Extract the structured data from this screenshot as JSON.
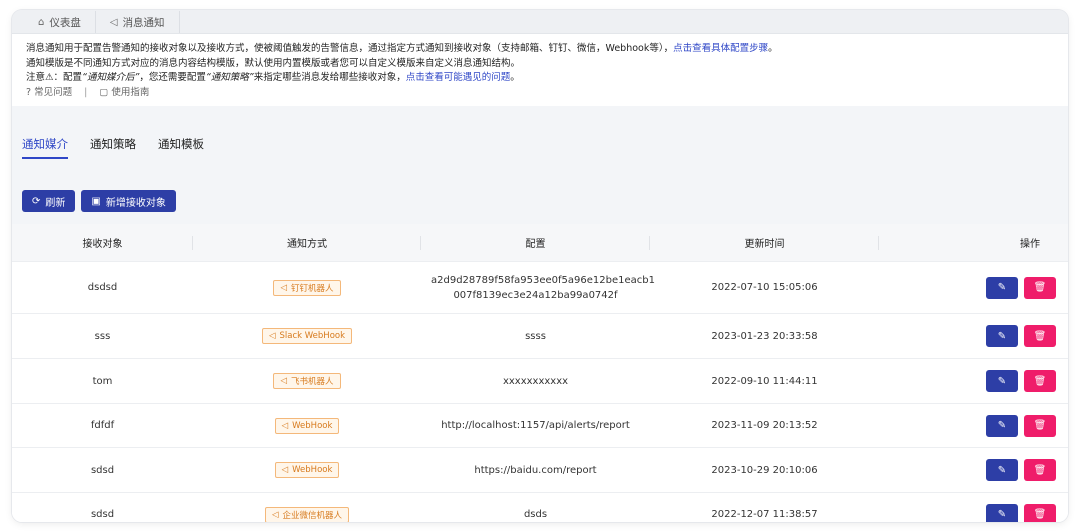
{
  "tabs": [
    {
      "icon": "home-icon",
      "label": "仪表盘"
    },
    {
      "icon": "megaphone-icon",
      "label": "消息通知"
    }
  ],
  "notice": {
    "line1_text": "消息通知用于配置告警通知的接收对象以及接收方式，使被阈值触发的告警信息，通过指定方式通知到接收对象（支持邮箱、钉钉、微信，Webhook等），",
    "line1_link": "点击查看具体配置步骤",
    "line1_end": "。",
    "line2_text": "通知模版是不同通知方式对应的消息内容结构模版，默认使用内置模版或者您可以自定义模版来自定义消息通知结构。",
    "line3_prefix": "注意⚠：配置",
    "line3_em1": "“通知媒介后”",
    "line3_mid": "，您还需要配置",
    "line3_em2": "“通知策略”",
    "line3_after": "来指定哪些消息发给哪些接收对象，",
    "line3_link": "点击查看可能遇见的问题",
    "line3_end": "。",
    "faq": "常见问题",
    "separator": "|",
    "guide": "使用指南"
  },
  "subtabs": [
    "通知媒介",
    "通知策略",
    "通知模板"
  ],
  "toolbar": {
    "refresh": "刷新",
    "add": "新增接收对象"
  },
  "table": {
    "headers": [
      "接收对象",
      "通知方式",
      "配置",
      "更新时间",
      "操作"
    ],
    "rows": [
      {
        "receiver": "dsdsd",
        "method": "钉钉机器人",
        "config_l1": "a2d9d28789f58fa953ee0f5a96e12be1eacb1",
        "config_l2": "007f8139ec3e24a12ba99a0742f",
        "time": "2022-07-10 15:05:06"
      },
      {
        "receiver": "sss",
        "method": "Slack WebHook",
        "config_l1": "ssss",
        "config_l2": "",
        "time": "2023-01-23 20:33:58"
      },
      {
        "receiver": "tom",
        "method": "飞书机器人",
        "config_l1": "xxxxxxxxxxx",
        "config_l2": "",
        "time": "2022-09-10 11:44:11"
      },
      {
        "receiver": "fdfdf",
        "method": "WebHook",
        "config_l1": "http://localhost:1157/api/alerts/report",
        "config_l2": "",
        "time": "2023-11-09 20:13:52"
      },
      {
        "receiver": "sdsd",
        "method": "WebHook",
        "config_l1": "https://baidu.com/report",
        "config_l2": "",
        "time": "2023-10-29 20:10:06"
      },
      {
        "receiver": "sdsd",
        "method": "企业微信机器人",
        "config_l1": "dsds",
        "config_l2": "",
        "time": "2022-12-07 11:38:57"
      }
    ]
  },
  "colors": {
    "primary": "#2d3ea6",
    "danger": "#ef1d6a",
    "badge": "#d77a1d",
    "link": "#2f47c7"
  }
}
